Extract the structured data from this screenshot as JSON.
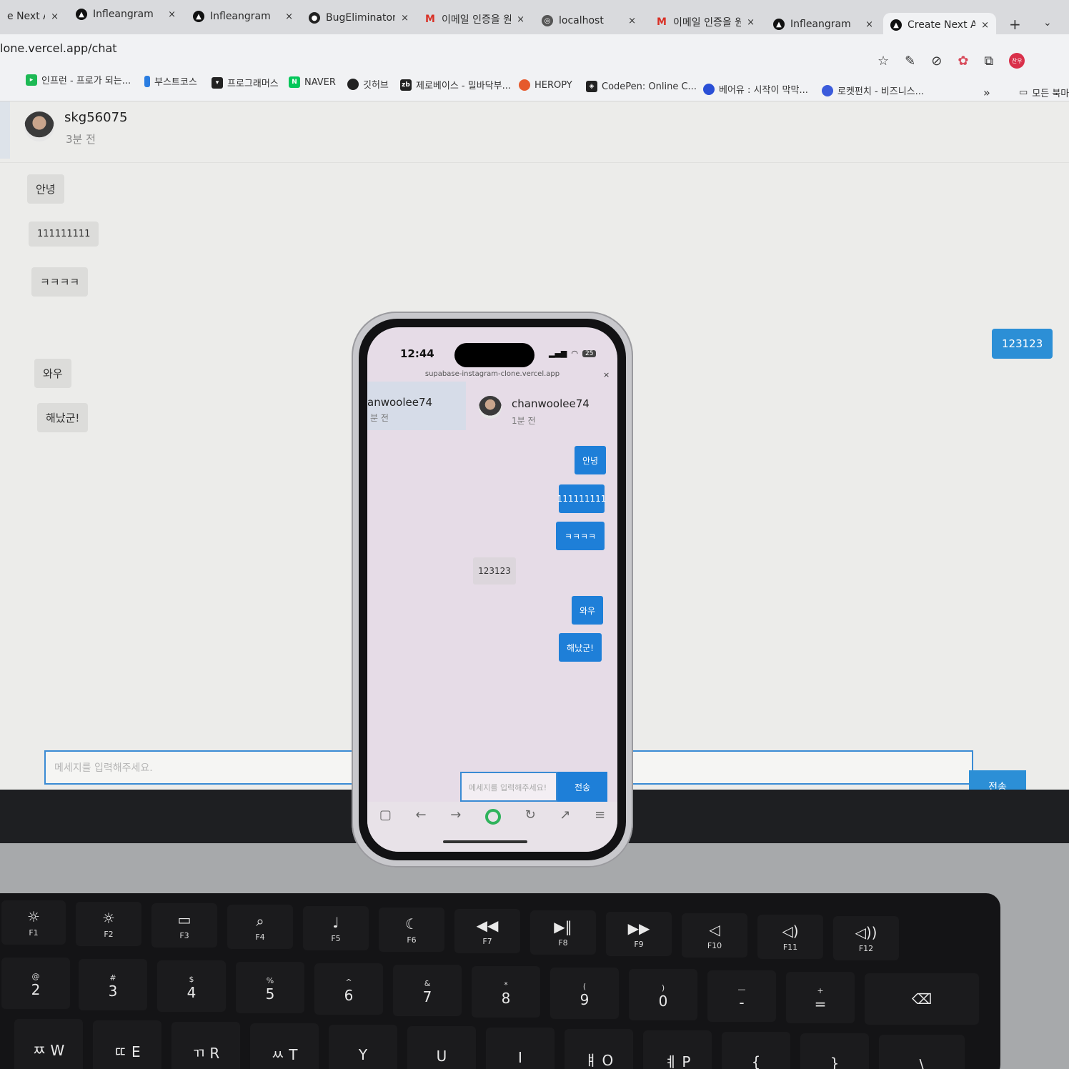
{
  "browser": {
    "tabs": [
      {
        "label": "e Next A",
        "icon": "none"
      },
      {
        "label": "Infleangram",
        "icon": "logo"
      },
      {
        "label": "Infleangram",
        "icon": "logo"
      },
      {
        "label": "BugEliminator",
        "icon": "github"
      },
      {
        "label": "이메일 인증을 원",
        "icon": "gmail"
      },
      {
        "label": "localhost",
        "icon": "globe"
      },
      {
        "label": "이메일 인증을 원",
        "icon": "gmail"
      },
      {
        "label": "Infleangram",
        "icon": "logo"
      },
      {
        "label": "Create Next A",
        "icon": "logo",
        "active": true
      }
    ],
    "close_glyph": "×",
    "new_tab": "+",
    "tab_menu": "⌄",
    "url": "lone.vercel.app/chat",
    "profile_label": "찬우",
    "bookmarks": [
      {
        "label": "인프런 - 프로가 되는...",
        "color": "#1db954"
      },
      {
        "label": "부스트코스",
        "color": "#2a7de1"
      },
      {
        "label": "프로그래머스",
        "color": "#222"
      },
      {
        "label": "NAVER",
        "color": "#03c75a"
      },
      {
        "label": "깃허브",
        "color": "#222"
      },
      {
        "label": "제로베이스 - 밀바닥부...",
        "color": "#222"
      },
      {
        "label": "HEROPY",
        "color": "#e65a2c"
      },
      {
        "label": "CodePen: Online C...",
        "color": "#222"
      },
      {
        "label": "베어유 : 시작이 막막...",
        "color": "#2a4fd6"
      },
      {
        "label": "로켓펀치 - 비즈니스...",
        "color": "#3b5bdb"
      }
    ],
    "bookmarks_more": "»",
    "all_bookmarks": "모든 북마"
  },
  "chat": {
    "user": "skg56075",
    "time": "3분 전",
    "received": [
      "안녕",
      "111111111",
      "ㅋㅋㅋㅋ",
      "와우",
      "해났군!"
    ],
    "sent": [
      "123123"
    ],
    "placeholder": "메세지를 입력해주세요.",
    "send_label": "전송"
  },
  "phone": {
    "time": "12:44",
    "battery": "25",
    "url": "supabase-instagram-clone.vercel.app",
    "close": "×",
    "contact_name": "anwoolee74",
    "contact_time": "분 전",
    "header_name": "chanwoolee74",
    "header_time": "1분 전",
    "sent": [
      "안녕",
      "111111111",
      "ㅋㅋㅋㅋ",
      "와우",
      "해났군!"
    ],
    "received": [
      "123123"
    ],
    "placeholder": "메세지를 입력해주세요!",
    "send_label": "전송"
  },
  "keyboard": {
    "fn_row": [
      "F1",
      "F2",
      "F3",
      "F4",
      "F5",
      "F6",
      "F7",
      "F8",
      "F9",
      "F10",
      "F11",
      "F12"
    ],
    "num_row": [
      {
        "top": "@",
        "main": "2"
      },
      {
        "top": "#",
        "main": "3"
      },
      {
        "top": "$",
        "main": "4"
      },
      {
        "top": "%",
        "main": "5"
      },
      {
        "top": "^",
        "main": "6"
      },
      {
        "top": "&",
        "main": "7"
      },
      {
        "top": "*",
        "main": "8"
      },
      {
        "top": "(",
        "main": "9"
      },
      {
        "top": ")",
        "main": "0"
      },
      {
        "top": "—",
        "main": "-"
      },
      {
        "top": "+",
        "main": "="
      }
    ],
    "letter_row": [
      "ㅉ W",
      "ㄸ E",
      "ㄲ R",
      "ㅆ T",
      "Y",
      "U",
      "I",
      "ㅒ O",
      "ㅖ P",
      "{",
      "}",
      "\\"
    ]
  }
}
